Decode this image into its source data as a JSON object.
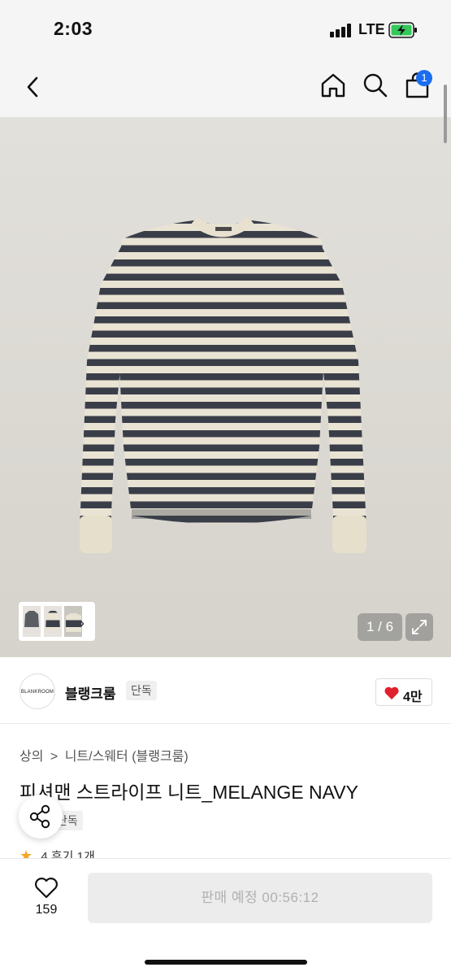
{
  "status_bar": {
    "time": "2:03",
    "network": "LTE"
  },
  "nav": {
    "cart_count": "1"
  },
  "gallery": {
    "page_counter": "1 / 6"
  },
  "brand": {
    "logo_text": "BLANKROOM",
    "name": "블랭크룸",
    "tag": "단독",
    "likes": "4만"
  },
  "product": {
    "breadcrumb": [
      "상의",
      ">",
      "니트/스웨터 (블랭크룸)"
    ],
    "title": "피셔맨 스트라이프 니트_MELANGE NAVY",
    "tag": "단독",
    "rating": "4",
    "reviews": "후기 1개"
  },
  "bottom": {
    "wish_count": "159",
    "sale_button": "판매 예정 00:56:12"
  },
  "colors": {
    "accent": "#1a6df0",
    "heart": "#e0202c",
    "star": "#f5a623",
    "stripe_dark": "#3a3e48",
    "stripe_light": "#e9e3d4"
  }
}
